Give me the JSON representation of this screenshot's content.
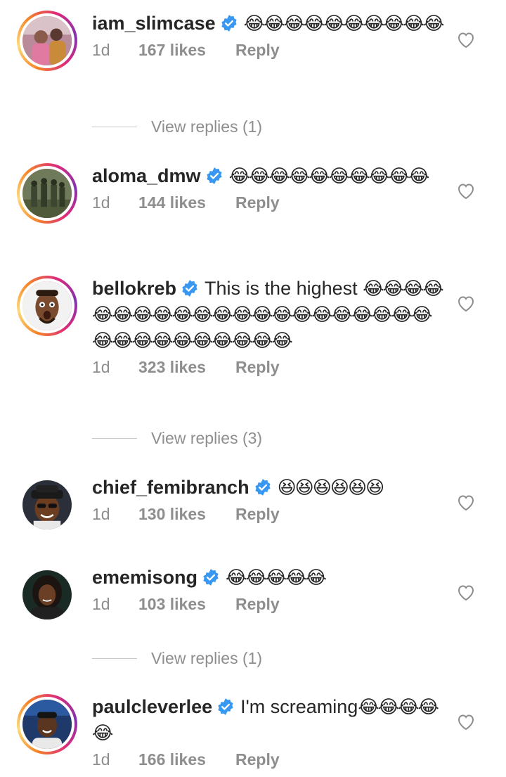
{
  "comments": [
    {
      "username": "iam_slimcase",
      "text": "",
      "emojis": "😂😂😂😂😂😂😂😂😂😂",
      "time": "1d",
      "likes": "167 likes",
      "reply": "Reply",
      "view_replies": "View replies (1)"
    },
    {
      "username": "aloma_dmw",
      "text": "",
      "emojis": "😂😂😂😂😂😂😂😂😂😂",
      "time": "1d",
      "likes": "144 likes",
      "reply": "Reply"
    },
    {
      "username": "bellokreb",
      "text": "This is the highest ",
      "emojis": "😂😂😂😂😂😂😂😂😂😂😂😂😂😂😂😂😂😂😂😂😂😂😂😂😂😂😂😂😂😂😂",
      "time": "1d",
      "likes": "323 likes",
      "reply": "Reply",
      "view_replies": "View replies (3)"
    },
    {
      "username": "chief_femibranch",
      "text": "",
      "emojis": "😆😆😆😆😆😆",
      "time": "1d",
      "likes": "130 likes",
      "reply": "Reply"
    },
    {
      "username": "ememisong",
      "text": "",
      "emojis": "😂😂😂😂😂",
      "time": "1d",
      "likes": "103 likes",
      "reply": "Reply",
      "view_replies": "View replies (1)"
    },
    {
      "username": "paulcleverlee",
      "text": "I'm screaming",
      "emojis": "😂😂😂😂😂",
      "time": "1d",
      "likes": "166 likes",
      "reply": "Reply"
    }
  ],
  "icons": {
    "verified": "verified-badge-icon",
    "like": "heart-outline-icon"
  },
  "colors": {
    "verified_blue": "#3897f0",
    "meta_gray": "#8e8e8e",
    "text": "#262626"
  }
}
